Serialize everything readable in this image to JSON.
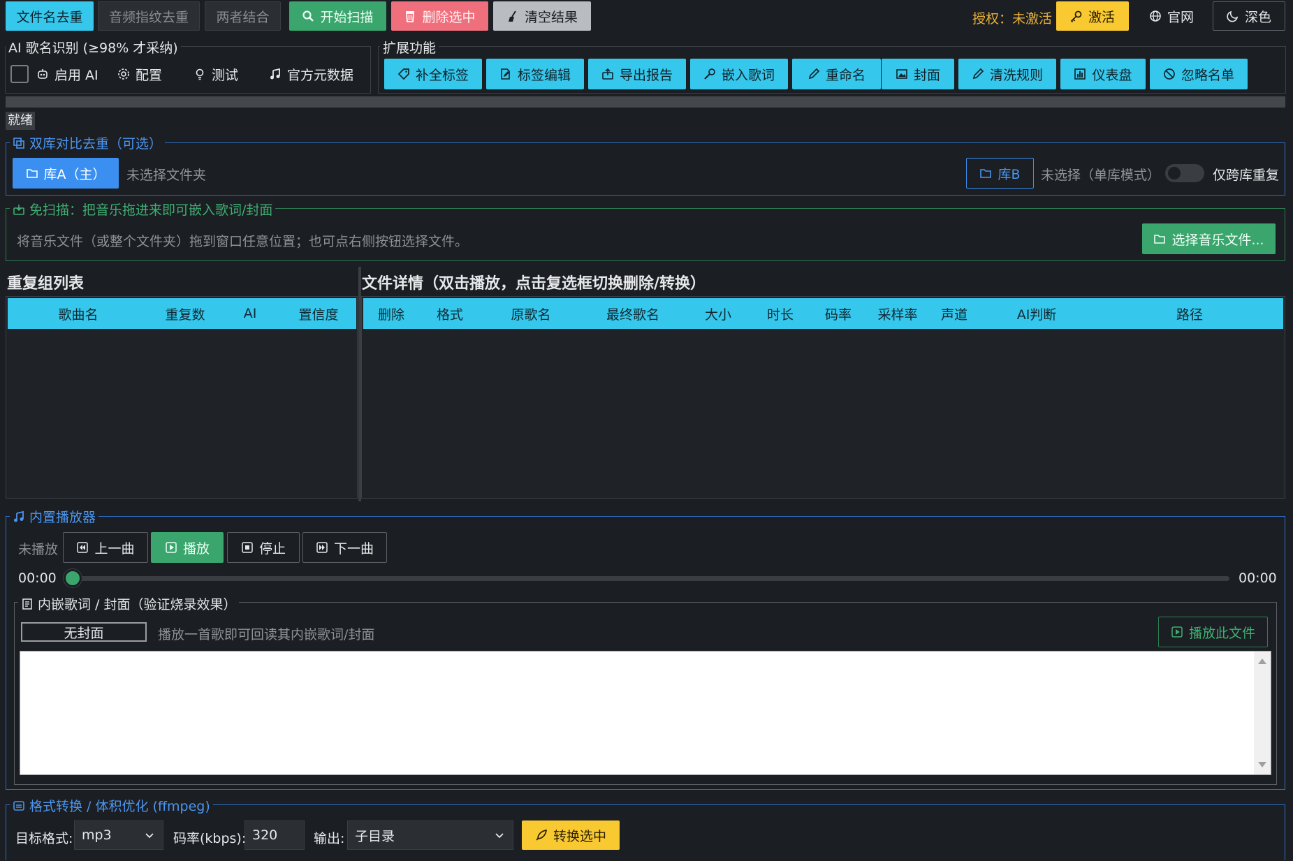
{
  "modes": {
    "filename": "文件名去重",
    "audio": "音频指纹去重",
    "both": "两者结合"
  },
  "actions": {
    "scan": "开始扫描",
    "delete": "删除选中",
    "clear": "清空结果"
  },
  "topright": {
    "license": "授权：未激活",
    "activate": "激活",
    "website": "官网",
    "theme": "深色"
  },
  "ai": {
    "legend": "AI 歌名识别 (≥98% 才采纳)",
    "enable": "启用 AI",
    "config": "配置",
    "test": "测试",
    "meta": "官方元数据"
  },
  "ext": {
    "legend": "扩展功能",
    "items": [
      "补全标签",
      "标签编辑",
      "导出报告",
      "嵌入歌词",
      "重命名",
      "封面",
      "清洗规则",
      "仪表盘",
      "忽略名单"
    ]
  },
  "status": "就绪",
  "dual": {
    "legend": "双库对比去重（可选）",
    "libA": "库A（主）",
    "libA_path": "未选择文件夹",
    "libB": "库B",
    "libB_path": "未选择（单库模式）",
    "cross_only": "仅跨库重复"
  },
  "noscan": {
    "legend": "免扫描：把音乐拖进来即可嵌入歌词/封面",
    "hint": "将音乐文件（或整个文件夹）拖到窗口任意位置；也可点右侧按钮选择文件。",
    "choose": "选择音乐文件..."
  },
  "groups": {
    "title": "重复组列表",
    "columns": [
      "歌曲名",
      "重复数",
      "AI",
      "置信度"
    ]
  },
  "details": {
    "title": "文件详情（双击播放，点击复选框切换删除/转换）",
    "columns": [
      "删除",
      "格式",
      "原歌名",
      "最终歌名",
      "大小",
      "时长",
      "码率",
      "采样率",
      "声道",
      "AI判断",
      "路径"
    ]
  },
  "player": {
    "legend": "内置播放器",
    "state": "未播放",
    "prev": "上一曲",
    "play": "播放",
    "stop": "停止",
    "next": "下一曲",
    "time_start": "00:00",
    "time_end": "00:00",
    "progress": 0
  },
  "lyrics": {
    "legend": "内嵌歌词 / 封面（验证烧录效果）",
    "no_cover": "无封面",
    "hint": "播放一首歌即可回读其内嵌歌词/封面",
    "play_file": "播放此文件",
    "text": ""
  },
  "convert": {
    "legend": "格式转换 / 体积优化 (ffmpeg)",
    "format_label": "目标格式:",
    "format": "mp3",
    "bitrate_label": "码率(kbps):",
    "bitrate": "320",
    "output_label": "输出:",
    "output": "子目录",
    "convert_btn": "转换选中"
  }
}
